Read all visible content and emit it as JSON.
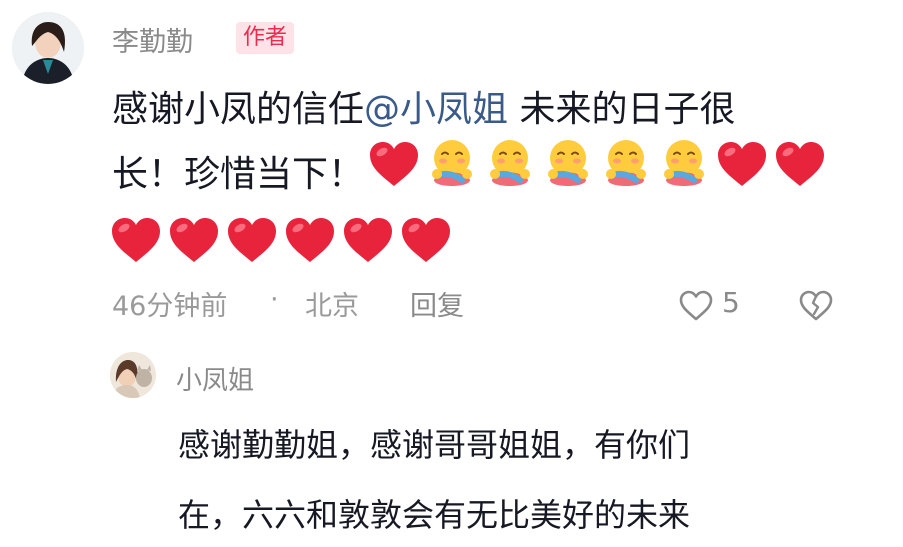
{
  "comment": {
    "author": "李勤勤",
    "author_badge": "作者",
    "text_before_mention": "感谢小凤的信任",
    "mention": "@小凤姐",
    "text_after_mention": " 未来的日子很",
    "line2_text": "长！珍惜当下！",
    "emoji_row_a": [
      "red-heart",
      "hug-face",
      "hug-face",
      "hug-face",
      "hug-face",
      "hug-face",
      "red-heart",
      "red-heart"
    ],
    "emoji_row_b": [
      "red-heart",
      "red-heart",
      "red-heart",
      "red-heart",
      "red-heart",
      "red-heart"
    ],
    "time": "46分钟前",
    "separator": "·",
    "location": "北京",
    "reply_label": "回复",
    "like_count": "5"
  },
  "reply": {
    "author": "小凤姐",
    "line1": "感谢勤勤姐，感谢哥哥姐姐，有你们",
    "line2": "在，六六和敦敦会有无比美好的未来"
  },
  "colors": {
    "badge_text": "#ee2a4f",
    "badge_bg": "#fde3e8",
    "heart": "#e8243d",
    "mention": "#3a5a8a"
  }
}
